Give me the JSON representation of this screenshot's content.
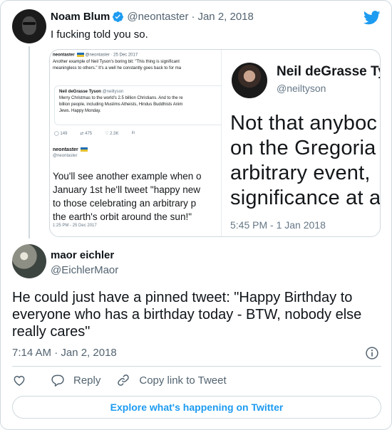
{
  "colors": {
    "brand": "#1d9bf0",
    "text": "#0f1419",
    "muted": "#536471",
    "border": "#cfd9de"
  },
  "parent_tweet": {
    "author_name": "Noam Blum",
    "handle": "@neontaster",
    "separator": "·",
    "date": "Jan 2, 2018",
    "text": "I fucking told you so.",
    "verified_icon": "verified-badge-icon",
    "brand_icon": "twitter-bird-icon"
  },
  "embedded_image": {
    "left": {
      "header_name": "neontaster",
      "header_meta": "@neontaster · 25 Dec 2017",
      "text_lines": [
        "Another example of Neil Tyson's boring bit: \"This thing is significant",
        "meaningless to others.\" It's a well he constantly goes back to for ma"
      ],
      "quote_name": "Neil deGrasse Tyson",
      "quote_handle": "@neiltyson",
      "quote_lines": [
        "Merry Christmas to the world's 2.5 billion Christians. And to the re",
        "billion people, including Muslims Atheists, Hindus Buddhists Anim",
        "Jews. Happy Monday."
      ],
      "stats": [
        "149",
        "475",
        "2.3K"
      ],
      "reply_name": "neontaster",
      "reply_handle": "@neontaster",
      "reply_lines": [
        "You'll see another example when o",
        "January 1st he'll tweet \"happy new",
        "to those celebrating an arbitrary p",
        "the earth's orbit around the sun!\""
      ],
      "time": "1:25 PM - 25 Dec 2017"
    },
    "right": {
      "name": "Neil deGrasse Ty",
      "handle": "@neiltyson",
      "lines": [
        "Not that anyboc",
        "on the Gregoria",
        "arbitrary event,",
        "significance at a"
      ],
      "time": "5:45 PM - 1 Jan 2018"
    }
  },
  "reply_tweet": {
    "author_name": "maor eichler",
    "handle": "@EichlerMaor",
    "text": "He could just have a pinned tweet: \"Happy Birthday to everyone who has a birthday today - BTW, nobody else really cares\"",
    "timestamp": "7:14 AM · Jan 2, 2018",
    "info_icon": "info-icon"
  },
  "actions": {
    "like_icon": "heart-icon",
    "reply_label": "Reply",
    "copy_label": "Copy link to Tweet"
  },
  "footer": {
    "explore_label": "Explore what's happening on Twitter"
  }
}
